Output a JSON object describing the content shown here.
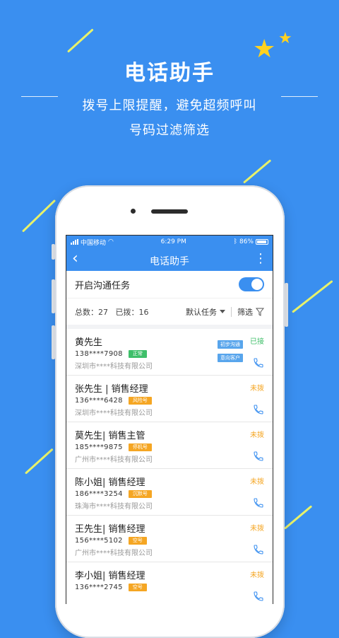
{
  "hero": {
    "title": "电话助手",
    "subtitle_line1": "拨号上限提醒，避免超频呼叫",
    "subtitle_line2": "号码过滤筛选"
  },
  "status_bar": {
    "carrier": "中国移动",
    "time": "6:29 PM",
    "battery": "86%"
  },
  "nav": {
    "back_glyph": "‹",
    "title": "电话助手",
    "more_glyph": "⋮"
  },
  "task_toggle": {
    "label": "开启沟通任务",
    "on": true
  },
  "stats": {
    "total_label": "总数：",
    "total_value": "27",
    "dialed_label": "已拨：",
    "dialed_value": "16",
    "sort_label": "默认任务",
    "filter_label": "筛选"
  },
  "contacts": [
    {
      "name": "黄先生",
      "phone": "138****7908",
      "badge": "正常",
      "badge_color": "#3fbf6a",
      "company": "深圳市****科技有限公司",
      "status": "已接",
      "status_color": "#3fbf6a",
      "tags": [
        "初步沟通",
        "意向客户"
      ]
    },
    {
      "name": "张先生 | 销售经理",
      "phone": "136****6428",
      "badge": "风险号",
      "badge_color": "#f5a623",
      "company": "深圳市****科技有限公司",
      "status": "未拨",
      "status_color": "#f5a623",
      "tags": []
    },
    {
      "name": "莫先生| 销售主管",
      "phone": "185****9875",
      "badge": "停机号",
      "badge_color": "#f5a623",
      "company": "广州市****科技有限公司",
      "status": "未拨",
      "status_color": "#f5a623",
      "tags": []
    },
    {
      "name": "陈小姐| 销售经理",
      "phone": "186****3254",
      "badge": "沉默号",
      "badge_color": "#f5a623",
      "company": "珠海市****科技有限公司",
      "status": "未拨",
      "status_color": "#f5a623",
      "tags": []
    },
    {
      "name": "王先生| 销售经理",
      "phone": "156****5102",
      "badge": "空号",
      "badge_color": "#f5a623",
      "company": "广州市****科技有限公司",
      "status": "未拨",
      "status_color": "#f5a623",
      "tags": []
    },
    {
      "name": "李小姐| 销售经理",
      "phone": "136****2745",
      "badge": "空号",
      "badge_color": "#f5a623",
      "company": "",
      "status": "未拨",
      "status_color": "#f5a623",
      "tags": []
    }
  ],
  "colors": {
    "brand_blue": "#3a8ff0",
    "accent_yellow": "#ffd21f"
  }
}
